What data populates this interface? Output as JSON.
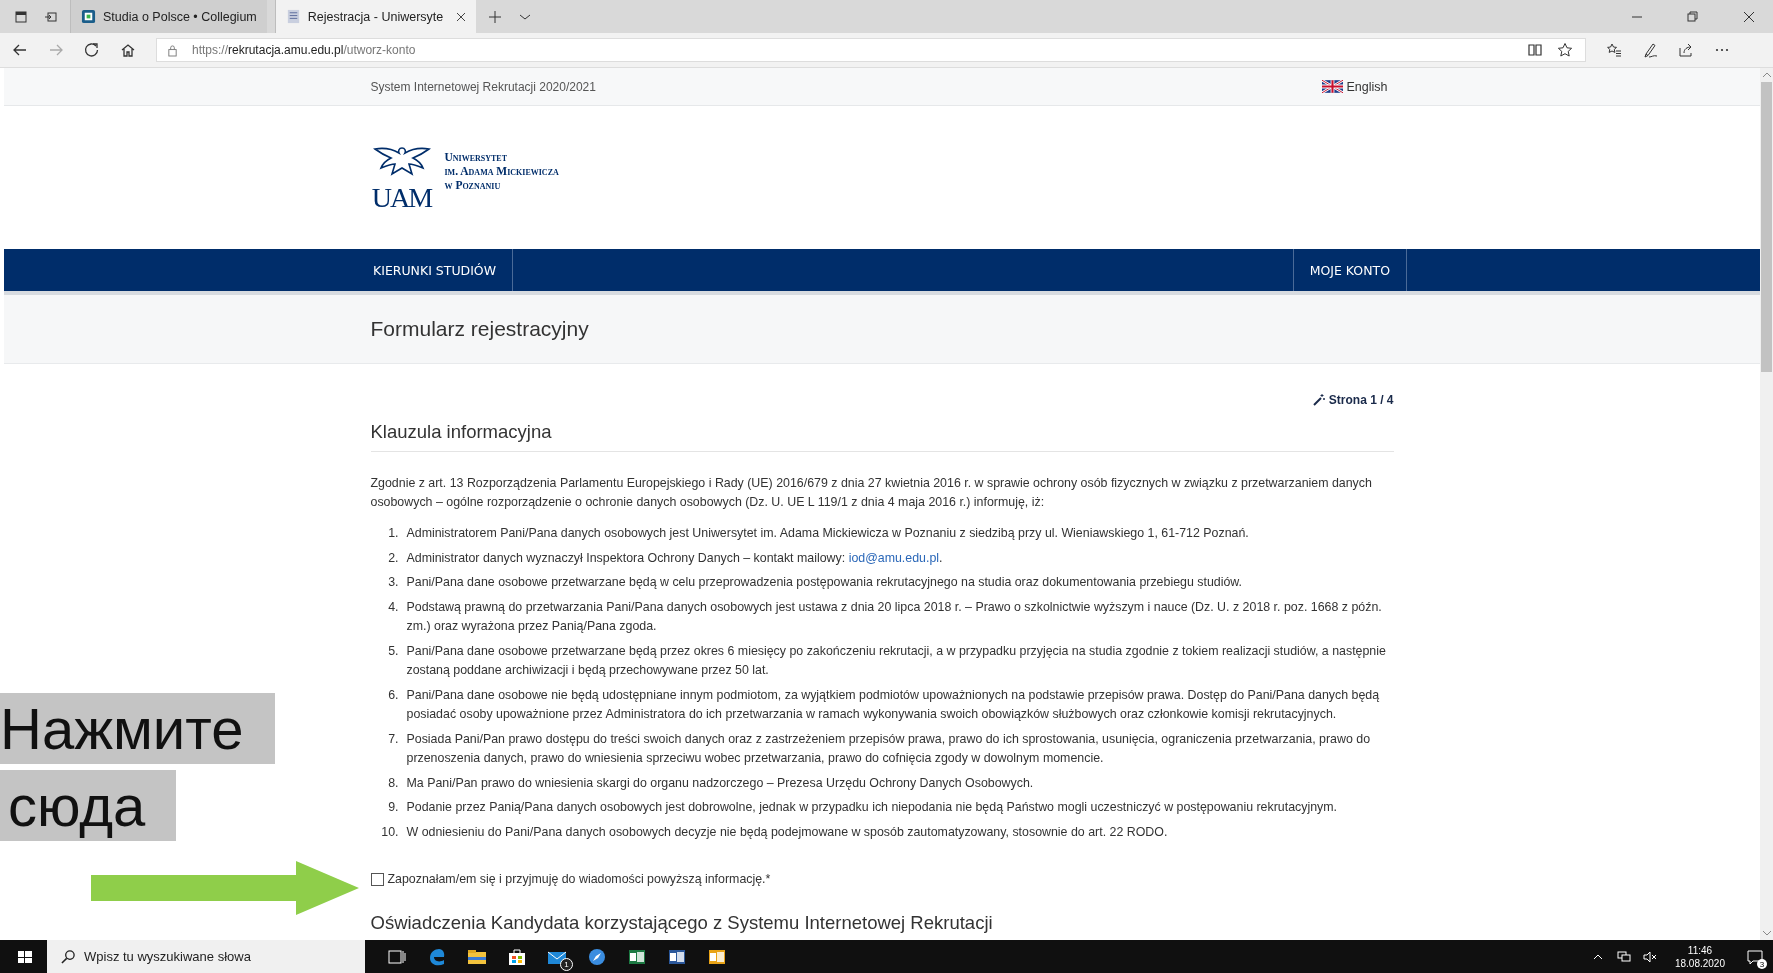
{
  "browser": {
    "tabs": [
      {
        "title": "Studia o Polsce • Collegium",
        "selected": false
      },
      {
        "title": "Rejestracja - Uniwersyte",
        "selected": true
      }
    ],
    "url": {
      "scheme": "https://",
      "host": "rekrutacja.amu.edu.pl",
      "path": "/utworz-konto"
    }
  },
  "page": {
    "top_bar": {
      "system_title": "System Internetowej Rekrutacji 2020/2021",
      "language": "English"
    },
    "logo": {
      "mark": "UAM",
      "lines": [
        "Uniwersytet",
        "im. Adama Mickiewicza",
        "w Poznaniu"
      ]
    },
    "nav": [
      {
        "label": "KIERUNKI STUDIÓW"
      },
      {
        "label": "MOJE KONTO"
      }
    ],
    "page_title": "Formularz rejestracyjny",
    "page_indicator": "Strona 1 / 4",
    "section_title": "Klauzula informacyjna",
    "intro": "Zgodnie z art. 13 Rozporządzenia Parlamentu Europejskiego i Rady (UE) 2016/679 z dnia 27 kwietnia 2016 r. w sprawie ochrony osób fizycznych w związku z przetwarzaniem danych osobowych – ogólne rozporządzenie o ochronie danych osobowych (Dz. U. UE L 119/1 z dnia 4 maja 2016 r.) informuję, iż:",
    "items": [
      {
        "number": "1.",
        "text": "Administratorem Pani/Pana danych osobowych jest Uniwersytet im. Adama Mickiewicza w Poznaniu z siedzibą przy ul. Wieniawskiego 1, 61-712 Poznań."
      },
      {
        "number": "2.",
        "text": "Administrator danych wyznaczył Inspektora Ochrony Danych – kontakt mailowy: ",
        "link": "iod@amu.edu.pl",
        "after": "."
      },
      {
        "number": "3.",
        "text": "Pani/Pana dane osobowe przetwarzane będą w celu przeprowadzenia postępowania rekrutacyjnego na studia oraz dokumentowania przebiegu studiów."
      },
      {
        "number": "4.",
        "text": "Podstawą prawną do przetwarzania Pani/Pana danych osobowych jest ustawa z dnia 20 lipca 2018 r. – Prawo o szkolnictwie wyższym i nauce (Dz. U. z 2018 r. poz. 1668 z późn. zm.) oraz wyrażona przez Panią/Pana zgoda."
      },
      {
        "number": "5.",
        "text": "Pani/Pana dane osobowe przetwarzane będą przez okres 6 miesięcy po zakończeniu rekrutacji, a w przypadku przyjęcia na studia zgodnie z tokiem realizacji studiów, a następnie zostaną poddane archiwizacji i będą przechowywane przez 50 lat."
      },
      {
        "number": "6.",
        "text": "Pani/Pana dane osobowe nie będą udostępniane innym podmiotom, za wyjątkiem podmiotów upoważnionych na podstawie przepisów prawa. Dostęp do Pani/Pana danych będą posiadać osoby upoważnione przez Administratora do ich przetwarzania w ramach wykonywania swoich obowiązków służbowych oraz członkowie komisji rekrutacyjnych."
      },
      {
        "number": "7.",
        "text": "Posiada Pani/Pan prawo dostępu do treści swoich danych oraz z zastrzeżeniem przepisów prawa, prawo do ich sprostowania, usunięcia, ograniczenia przetwarzania, prawo do przenoszenia danych, prawo do wniesienia sprzeciwu wobec przetwarzania, prawo do cofnięcia zgody w dowolnym momencie."
      },
      {
        "number": "8.",
        "text": "Ma Pani/Pan prawo do wniesienia skargi do organu nadzorczego – Prezesa Urzędu Ochrony Danych Osobowych."
      },
      {
        "number": "9.",
        "text": "Podanie przez Panią/Pana danych osobowych jest dobrowolne, jednak w przypadku ich niepodania nie będą Państwo mogli uczestniczyć w postępowaniu rekrutacyjnym."
      },
      {
        "number": "10.",
        "text": "W odniesieniu do Pani/Pana danych osobowych decyzje nie będą podejmowane w sposób zautomatyzowany, stosownie do art. 22 RODO."
      }
    ],
    "consent": {
      "label": "Zapoznałam/em się i przyjmuję do wiadomości powyższą informację.*",
      "checked": false
    },
    "next_section_title": "Oświadczenia Kandydata korzystającego z Systemu Internetowej Rekrutacji"
  },
  "overlay": {
    "lines": [
      "Нажмите",
      "сюда"
    ]
  },
  "taskbar": {
    "search_placeholder": "Wpisz tu wyszukiwane słowa",
    "apps": [
      {
        "kind": "taskview"
      },
      {
        "kind": "edge"
      },
      {
        "kind": "explorer"
      },
      {
        "kind": "store"
      },
      {
        "kind": "mail",
        "badge": "1"
      },
      {
        "kind": "compass"
      },
      {
        "kind": "excel"
      },
      {
        "kind": "word"
      },
      {
        "kind": "outlook"
      }
    ],
    "time": "11:46",
    "date": "18.08.2020",
    "notifications": "3"
  }
}
